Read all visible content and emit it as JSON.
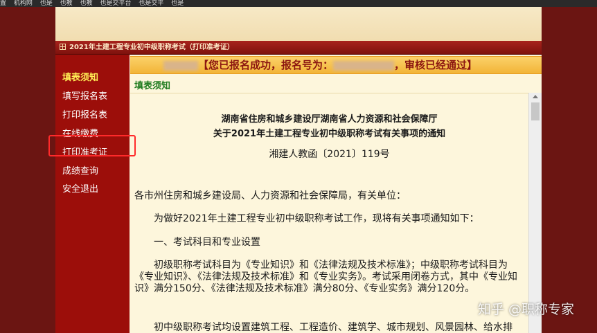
{
  "browser": {
    "bookmarks": [
      "置",
      "机构网",
      "也是",
      "也教",
      "也教",
      "也是交平台",
      "也是交平",
      "也是"
    ]
  },
  "header": {
    "title": "2021年土建工程专业初中级职称考试（打印准考证）"
  },
  "sidebar": {
    "items": [
      {
        "label": "填表须知",
        "active": true
      },
      {
        "label": "填写报名表"
      },
      {
        "label": "打印报名表"
      },
      {
        "label": "在线缴费"
      },
      {
        "label": "打印准考证",
        "highlighted": true
      },
      {
        "label": "成绩查询"
      },
      {
        "label": "安全退出"
      }
    ]
  },
  "status": {
    "part1": "【您已报名成功，报名号为：",
    "part2": "，审核已经通过】"
  },
  "section": {
    "label": "填表须知"
  },
  "document": {
    "title1": "湖南省住房和城乡建设厅湖南省人力资源和社会保障厅",
    "title2": "关于2021年土建工程专业初中级职称考试有关事项的通知",
    "ref": "湘建人教函〔2021〕119号",
    "salutation": "各市州住房和城乡建设局、人力资源和社会保障局，有关单位：",
    "intro": "为做好2021年土建工程专业初中级职称考试工作，现将有关事项通知如下：",
    "heading1": "一、考试科目和专业设置",
    "para1": "初级职称考试科目为《专业知识》和《法律法规及技术标准》；中级职称考试科目为《专业知识》、《法律法规及技术标准》和《专业实务》。考试采用闭卷方式，其中《专业知识》满分150分、《法律法规及技术标准》满分80分、《专业实务》满分120分。",
    "para2": "初中级职称考试均设置建筑工程、工程造价、建筑学、城市规划、风景园林、给水排水、建筑环境与设备、市政公用工程、工程建设自制随运等专业"
  },
  "watermark": {
    "text": "知乎 @职称专家"
  }
}
